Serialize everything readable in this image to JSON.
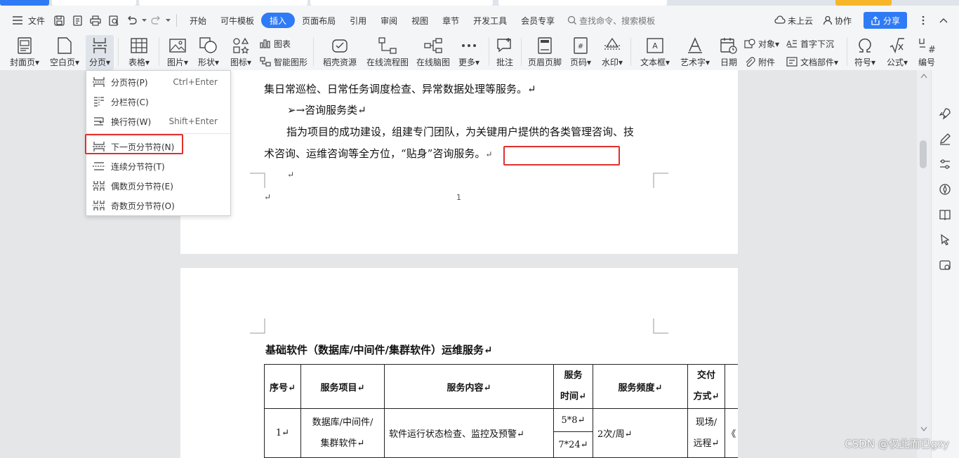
{
  "menubar": {
    "file_label": "文件",
    "tabs": [
      "开始",
      "可牛模板",
      "插入",
      "页面布局",
      "引用",
      "审阅",
      "视图",
      "章节",
      "开发工具",
      "会员专享"
    ],
    "active_tab": "插入",
    "search_placeholder": "查找命令、搜索模板",
    "cloud_label": "未上云",
    "collab_label": "协作",
    "share_label": "分享"
  },
  "ribbon": {
    "cover": "封面页",
    "blank": "空白页",
    "pagebreak": "分页",
    "table": "表格",
    "picture": "图片",
    "shape": "形状",
    "icon": "图标",
    "chart": "图表",
    "smartart": "智能图形",
    "docer": "稻壳资源",
    "flowchart": "在线流程图",
    "mindmap": "在线脑图",
    "more": "更多",
    "comment": "批注",
    "headerfooter": "页眉页脚",
    "pagenum": "页码",
    "watermark": "水印",
    "textbox": "文本框",
    "wordart": "艺术字",
    "date": "日期",
    "object": "对象",
    "attachment": "附件",
    "dropcap": "首字下沉",
    "docpart": "文档部件",
    "symbol": "符号",
    "formula": "公式",
    "numbering": "编号"
  },
  "dropdown": {
    "items": [
      {
        "label": "分页符(P)",
        "shortcut": "Ctrl+Enter"
      },
      {
        "label": "分栏符(C)",
        "shortcut": ""
      },
      {
        "label": "换行符(W)",
        "shortcut": "Shift+Enter"
      },
      {
        "label": "下一页分节符(N)",
        "shortcut": ""
      },
      {
        "label": "连续分节符(T)",
        "shortcut": ""
      },
      {
        "label": "偶数页分节符(E)",
        "shortcut": ""
      },
      {
        "label": "奇数页分节符(O)",
        "shortcut": ""
      }
    ]
  },
  "document": {
    "line1": "集日常巡检、日常任务调度检查、异常数据处理等服务。↵",
    "bullet": "➢→咨询服务类↵",
    "para_line1": "指为项目的成功建设，组建专门团队，为关键用户提供的各类管理咨询、技",
    "para_line2": "术咨询、运维咨询等全方位，“贴身”咨询服务。",
    "para_mark": "↵",
    "empty_mark": "↵",
    "footer_mark": "↵",
    "page_number": "1",
    "section_title": "基础软件（数据库/中间件/集群软件）运维服务↵",
    "table": {
      "headers": [
        "序号↵",
        "服务项目↵",
        "服务内容↵",
        "服务时间↵",
        "服务频度↵",
        "交付方式↵"
      ],
      "header_time_lines": [
        "服务",
        "时间↵"
      ],
      "header_delivery_lines": [
        "交付",
        "方式↵"
      ],
      "row1": {
        "no": "1↵",
        "item_lines": [
          "数据库/中间件/",
          "集群软件↵"
        ],
        "content": "软件运行状态检查、监控及预警↵",
        "time_a": "5*8↵",
        "time_b": "7*24↵",
        "freq": "2次/周↵",
        "delivery_lines": [
          "现场/",
          "远程↵"
        ],
        "extra": "《"
      }
    }
  },
  "watermark": "CSDN @仅此而已gzy"
}
